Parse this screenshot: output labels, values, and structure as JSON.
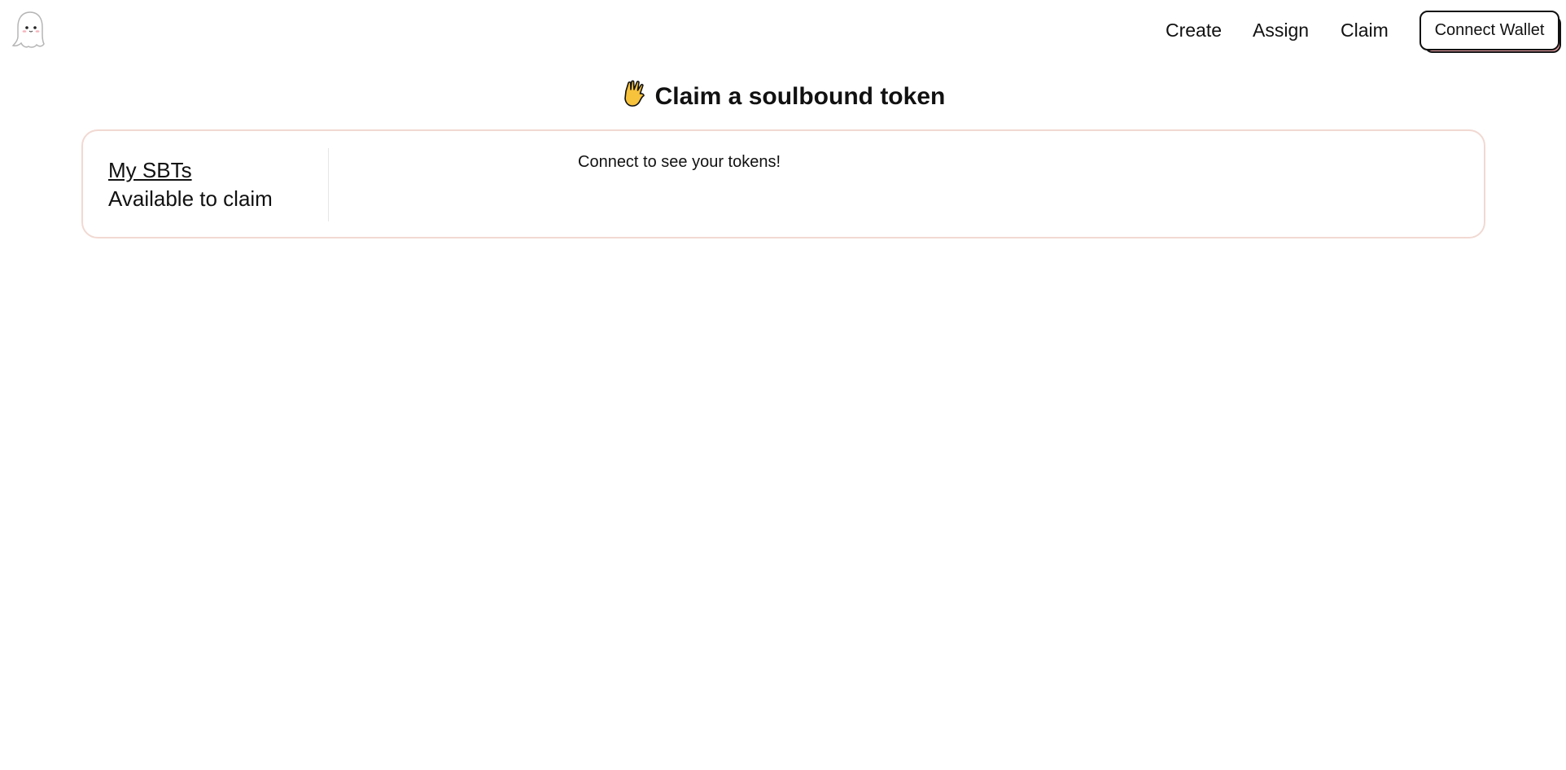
{
  "header": {
    "logo_icon": "ghost-icon",
    "nav": {
      "create": "Create",
      "assign": "Assign",
      "claim": "Claim"
    },
    "connect_wallet": "Connect Wallet"
  },
  "page": {
    "title_icon": "vulcan-salute-icon",
    "title": "Claim a soulbound token"
  },
  "card": {
    "tabs": {
      "my_sbts": "My SBTs",
      "available": "Available to claim"
    },
    "active_tab": "My SBTs",
    "empty_message": "Connect to see your tokens!"
  },
  "colors": {
    "card_border": "#f1d9d2",
    "button_shadow": "#f2a5ab",
    "text": "#111111",
    "hand": "#f7c23c"
  }
}
